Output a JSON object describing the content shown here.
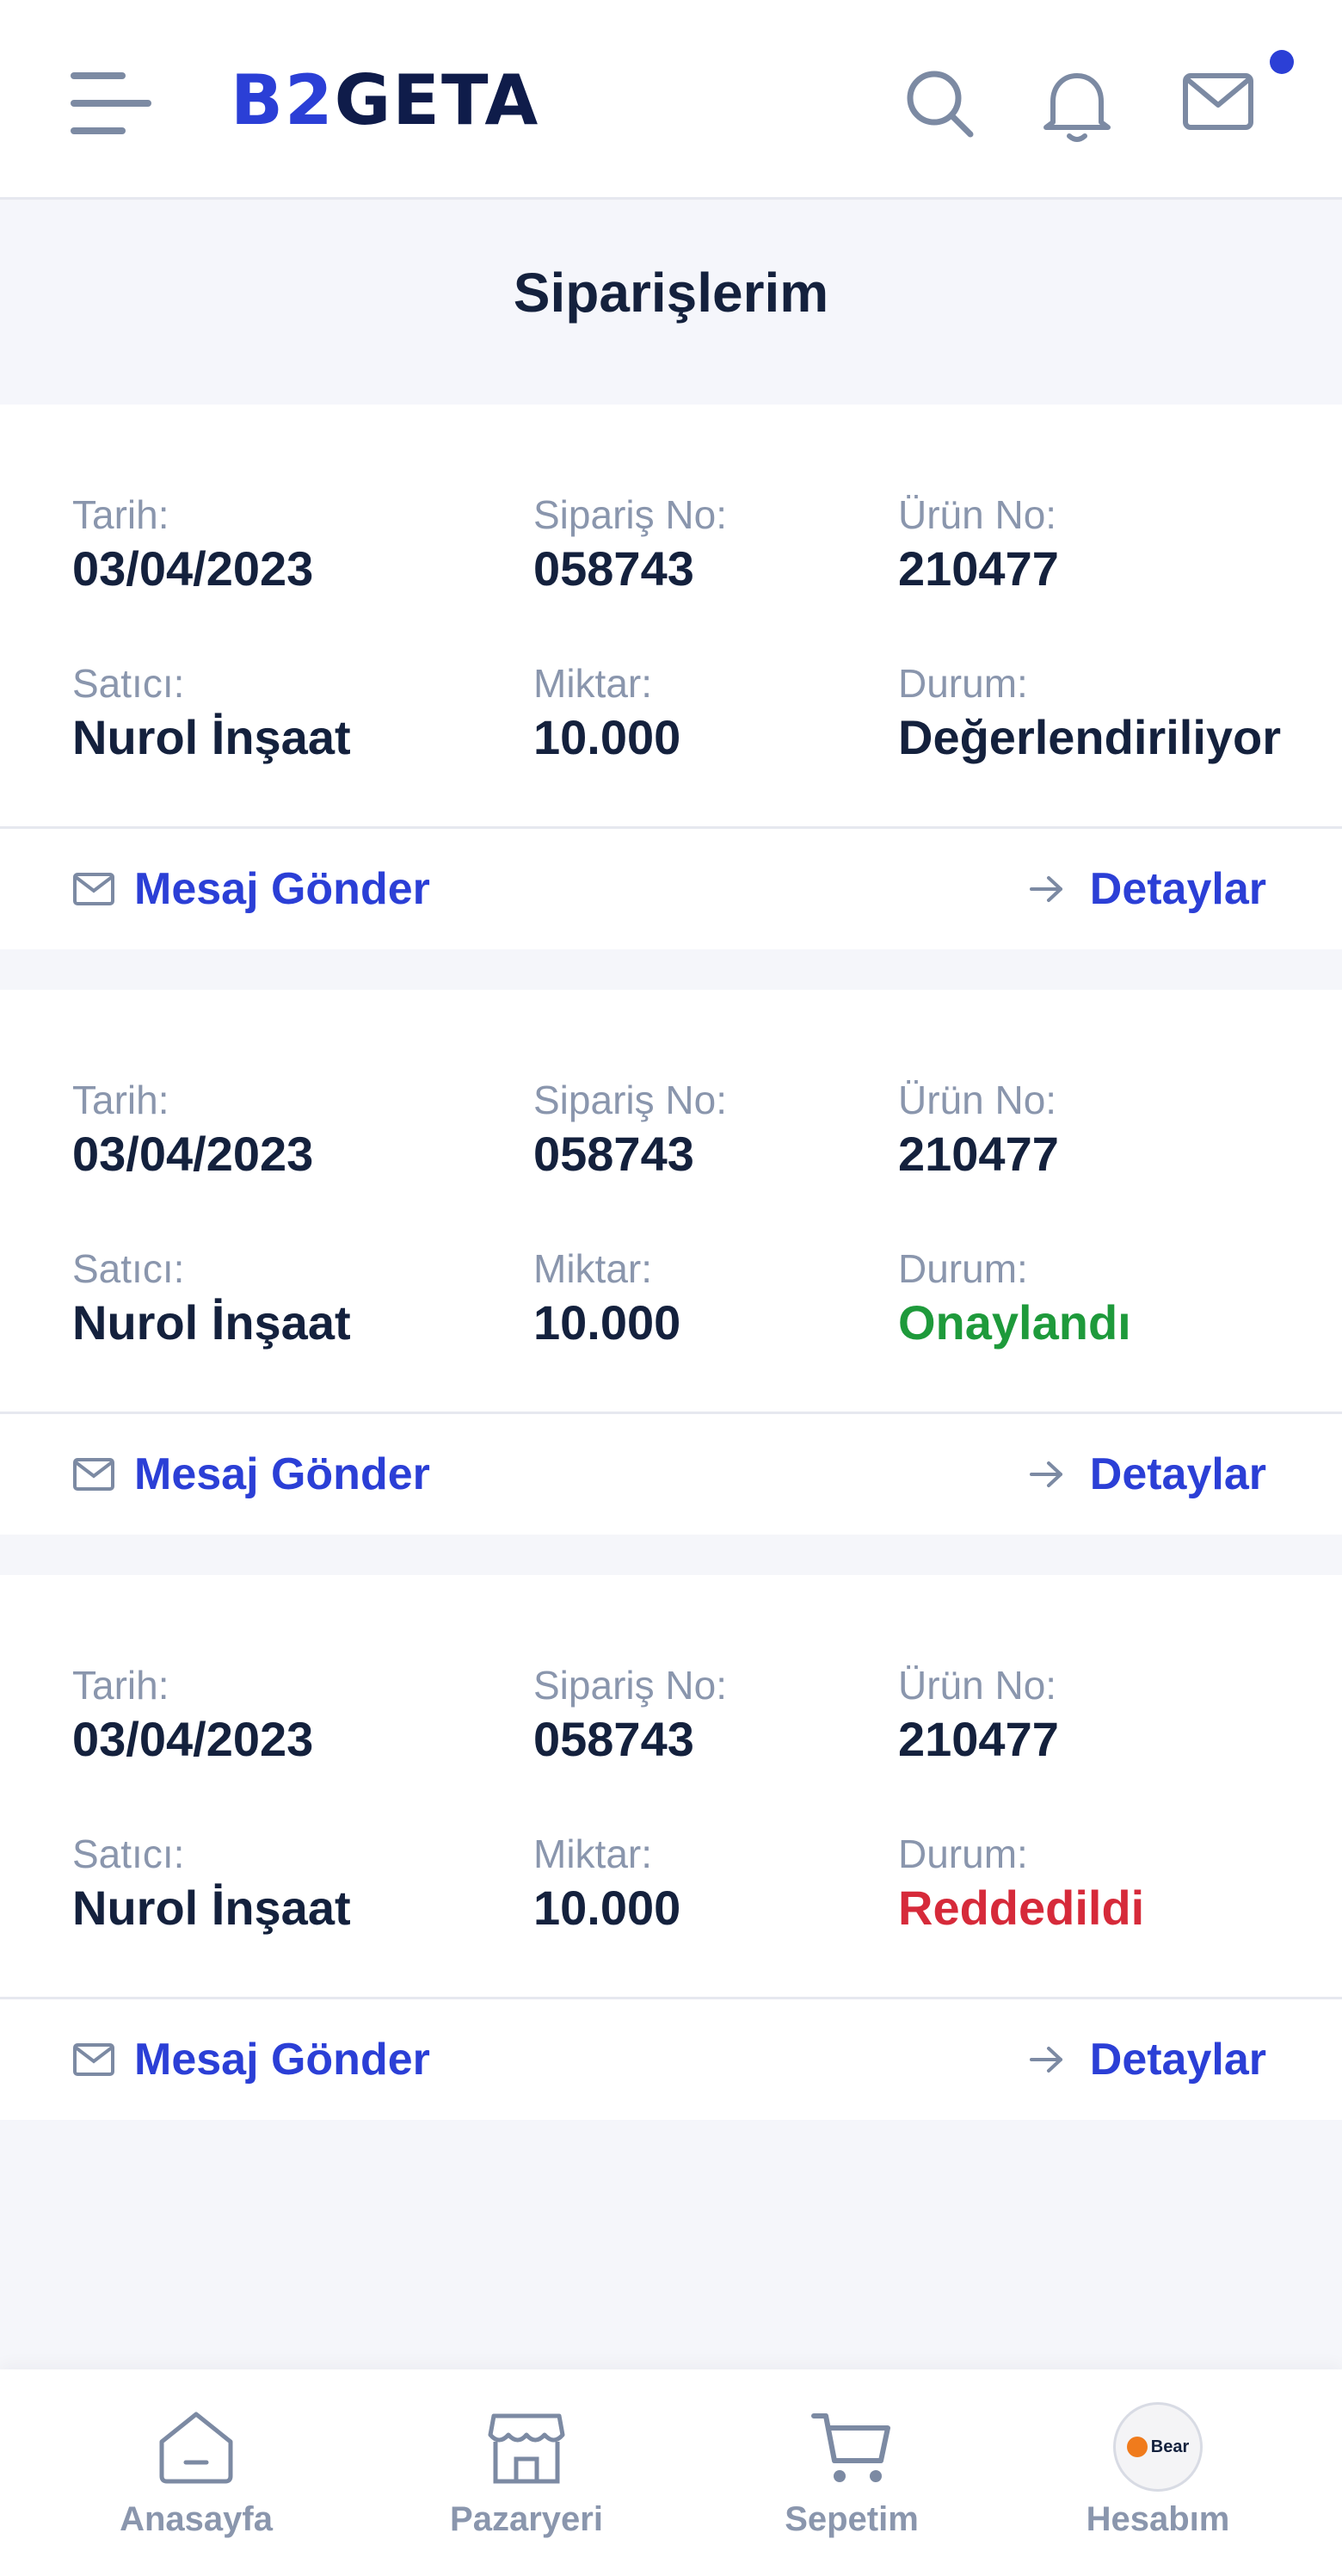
{
  "header": {
    "logo_b2": "B2",
    "logo_geta": "GETA",
    "icons": [
      "menu-icon",
      "search-icon",
      "bell-icon",
      "mail-icon"
    ],
    "mail_has_notification": true
  },
  "page": {
    "title": "Siparişlerim"
  },
  "labels": {
    "date": "Tarih:",
    "order_no": "Sipariş No:",
    "product_no": "Ürün No:",
    "seller": "Satıcı:",
    "quantity": "Miktar:",
    "status": "Durum:",
    "send_message": "Mesaj Gönder",
    "details": "Detaylar"
  },
  "orders": [
    {
      "date": "03/04/2023",
      "order_no": "058743",
      "product_no": "210477",
      "seller": "Nurol İnşaat",
      "quantity": "10.000",
      "status": "Değerlendiriliyor",
      "status_color": "#14213d"
    },
    {
      "date": "03/04/2023",
      "order_no": "058743",
      "product_no": "210477",
      "seller": "Nurol İnşaat",
      "quantity": "10.000",
      "status": "Onaylandı",
      "status_color": "#1e9a3b"
    },
    {
      "date": "03/04/2023",
      "order_no": "058743",
      "product_no": "210477",
      "seller": "Nurol İnşaat",
      "quantity": "10.000",
      "status": "Reddedildi",
      "status_color": "#d62a3a"
    }
  ],
  "bottom_nav": {
    "home": "Anasayfa",
    "market": "Pazaryeri",
    "cart": "Sepetim",
    "account": "Hesabım",
    "avatar_text": "Bear"
  },
  "colors": {
    "accent": "#2b3fd6",
    "text": "#14213d",
    "muted": "#8a96ad",
    "approved": "#1e9a3b",
    "rejected": "#d62a3a"
  }
}
